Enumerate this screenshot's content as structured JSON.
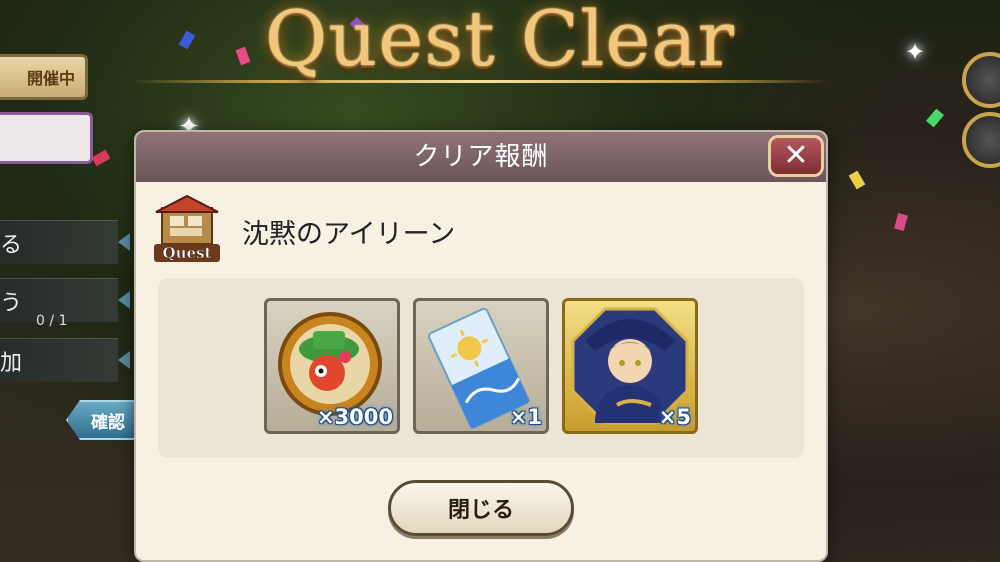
{
  "screen": {
    "title": "Quest Clear"
  },
  "side_menu": {
    "status_tag": "開催中",
    "rows": [
      {
        "label": "る"
      },
      {
        "label": "う"
      },
      {
        "label": "加"
      }
    ],
    "progress": "0 / 1",
    "confirm_label": "確認"
  },
  "dialog": {
    "title": "クリア報酬",
    "close_icon": "close-icon",
    "quest_badge_label": "Quest",
    "quest_name": "沈黙のアイリーン",
    "rewards": [
      {
        "item": "coin-medal",
        "quantity": "×3000"
      },
      {
        "item": "sun-ticket",
        "quantity": "×1"
      },
      {
        "item": "character-portrait",
        "quantity": "×5"
      }
    ],
    "close_button_label": "閉じる"
  },
  "colors": {
    "title_gold": "#f3c77a",
    "dialog_header": "#7d6468",
    "close_red": "#a0424a",
    "panel_bg": "#f6f1e3"
  }
}
